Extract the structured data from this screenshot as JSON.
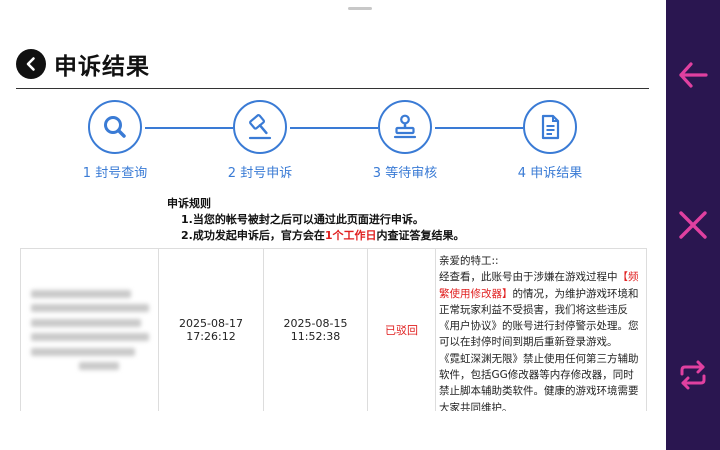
{
  "header": {
    "title": "申诉结果"
  },
  "steps": [
    {
      "label": "1 封号查询",
      "icon": "search-icon"
    },
    {
      "label": "2 封号申诉",
      "icon": "gavel-icon"
    },
    {
      "label": "3 等待审核",
      "icon": "stamp-icon"
    },
    {
      "label": "4 申诉结果",
      "icon": "document-icon"
    }
  ],
  "rules": {
    "title": "申诉规则",
    "item1": "1.当您的帐号被封之后可以通过此页面进行申诉。",
    "item2_pre": "2.成功发起申诉后，官方会在",
    "item2_highlight": "1个工作日",
    "item2_post": "内查证答复结果。"
  },
  "record": {
    "submit_date": "2025-08-17",
    "submit_time": "17:26:12",
    "ban_date": "2025-08-15",
    "ban_time": "11:52:38",
    "status": "已驳回",
    "message": {
      "greeting": "亲爱的特工::",
      "line1_pre": "经查看，此账号由于涉嫌在游戏过程中",
      "line1_highlight": "【频繁使用修改器】",
      "line1_post": "的情况，为维护游戏环境和正常玩家利益不受损害，我们将这些违反《用户协议》的账号进行封停警示处理。您可以在封停时间到期后重新登录游戏。",
      "line2": "《霓虹深渊无限》禁止使用任何第三方辅助软件，包括GG修改器等内存修改器，同时禁止脚本辅助类软件。健康的游戏环境需要大家共同维护。"
    }
  },
  "sidebar": {
    "buttons": [
      "back-arrow-icon",
      "close-icon",
      "switch-icon"
    ]
  },
  "colors": {
    "accent": "#3a7bd5",
    "highlight": "#e02020",
    "sidebar": "#2a1650",
    "sidebar_icon": "#e040a0"
  }
}
